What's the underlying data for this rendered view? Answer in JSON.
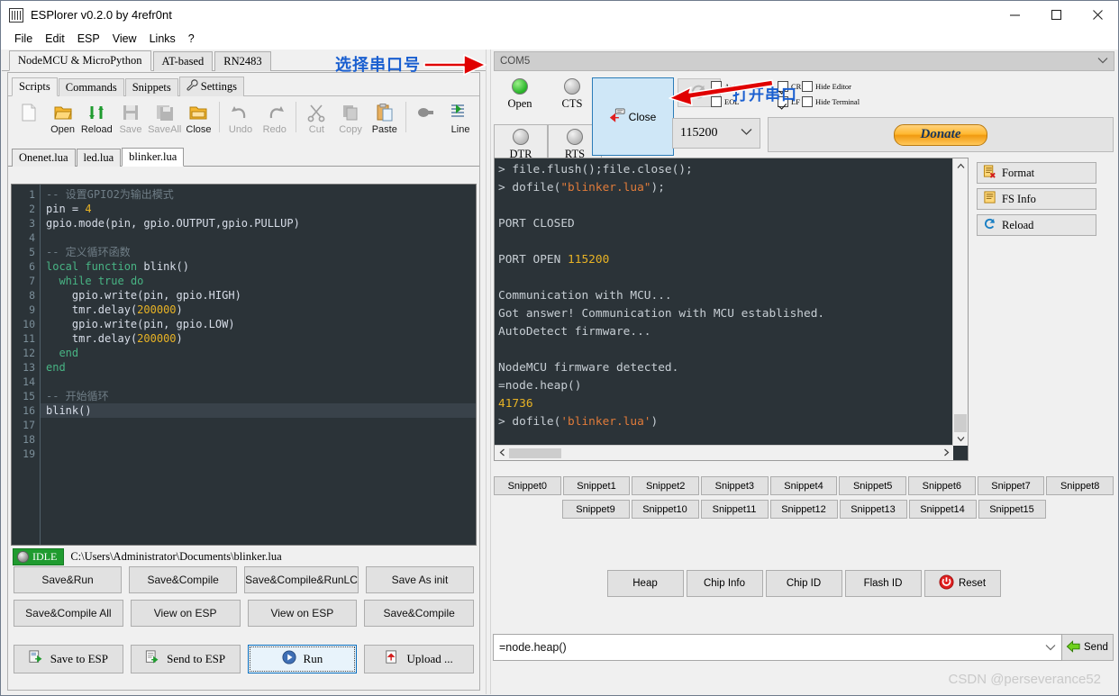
{
  "window": {
    "title": "ESPlorer v0.2.0 by 4refr0nt",
    "minimize": "─",
    "maximize": "☐",
    "close": "✕"
  },
  "menu": [
    "File",
    "Edit",
    "ESP",
    "View",
    "Links",
    "?"
  ],
  "outer_tabs": [
    {
      "label": "NodeMCU & MicroPython",
      "active": true
    },
    {
      "label": "AT-based",
      "active": false
    },
    {
      "label": "RN2483",
      "active": false
    }
  ],
  "inner_tabs": [
    {
      "label": "Scripts",
      "active": true
    },
    {
      "label": "Commands",
      "active": false
    },
    {
      "label": "Snippets",
      "active": false
    },
    {
      "label": "Settings",
      "active": false,
      "icon": "wrench-icon"
    }
  ],
  "editor_toolbar": [
    {
      "label": "",
      "icon": "new-file-icon",
      "disabled": false
    },
    {
      "label": "Open",
      "icon": "open-folder-icon",
      "disabled": false
    },
    {
      "label": "Reload",
      "icon": "reload-icon",
      "disabled": false
    },
    {
      "label": "Save",
      "icon": "save-icon",
      "disabled": true
    },
    {
      "label": "SaveAll",
      "icon": "save-all-icon",
      "disabled": true
    },
    {
      "label": "Close",
      "icon": "close-folder-icon",
      "disabled": false
    },
    {
      "label": "Undo",
      "icon": "undo-icon",
      "disabled": true
    },
    {
      "label": "Redo",
      "icon": "redo-icon",
      "disabled": true
    },
    {
      "label": "Cut",
      "icon": "scissors-icon",
      "disabled": true
    },
    {
      "label": "Copy",
      "icon": "copy-icon",
      "disabled": true
    },
    {
      "label": "Paste",
      "icon": "paste-icon",
      "disabled": false
    },
    {
      "label": "",
      "icon": "block-icon",
      "disabled": true
    },
    {
      "label": "Line",
      "icon": "line-icon",
      "disabled": false
    }
  ],
  "file_tabs": [
    {
      "label": "Onenet.lua",
      "active": false
    },
    {
      "label": "led.lua",
      "active": false
    },
    {
      "label": "blinker.lua",
      "active": true
    }
  ],
  "code": {
    "lines": [
      "1",
      "2",
      "3",
      "4",
      "5",
      "6",
      "7",
      "8",
      "9",
      "10",
      "11",
      "12",
      "13",
      "14",
      "15",
      "16",
      "17",
      "18",
      "19"
    ],
    "text": [
      "-- 设置GPIO2为输出模式",
      "pin = 4",
      "gpio.mode(pin, gpio.OUTPUT,gpio.PULLUP)",
      "",
      "-- 定义循环函数",
      "local function blink()",
      "  while true do",
      "    gpio.write(pin, gpio.HIGH)",
      "    tmr.delay(200000)",
      "    gpio.write(pin, gpio.LOW)",
      "    tmr.delay(200000)",
      "  end",
      "end",
      "",
      "-- 开始循环",
      "blink()",
      "",
      "",
      ""
    ],
    "current_line": 16
  },
  "status": {
    "badge": "IDLE",
    "path": "C:\\Users\\Administrator\\Documents\\blinker.lua"
  },
  "action_buttons_row1": [
    "Save&Run",
    "Save&Compile",
    "Save&Compile&RunLC",
    "Save As init"
  ],
  "action_buttons_row2": [
    "Save&Compile All",
    "View on ESP",
    "View on ESP",
    "Save&Compile"
  ],
  "action_buttons_row3": [
    {
      "label": "Save to ESP",
      "icon": "save-to-esp-icon",
      "focused": false
    },
    {
      "label": "Send to ESP",
      "icon": "send-to-esp-icon",
      "focused": false
    },
    {
      "label": "Run",
      "icon": "run-icon",
      "focused": true
    },
    {
      "label": "Upload ...",
      "icon": "upload-icon",
      "focused": false
    }
  ],
  "serial": {
    "port_value": "COM5",
    "leds": [
      {
        "label": "Open",
        "state": "green"
      },
      {
        "label": "CTS",
        "state": "grey"
      }
    ],
    "buttons": [
      {
        "label": "DTR",
        "state": "grey"
      },
      {
        "label": "RTS",
        "state": "grey"
      }
    ],
    "open_close_label": "Close",
    "open_close_icon": "close-port-icon",
    "refresh_icon": "refresh-icon",
    "baud_value": "115200",
    "donate_label": "Donate",
    "checkboxes": [
      {
        "label": "AutoScroll",
        "checked": true
      },
      {
        "label": "EOL",
        "checked": false
      },
      {
        "label": "CR",
        "checked": true
      },
      {
        "label": "LF",
        "checked": true
      },
      {
        "label": "Hide Editor",
        "checked": false
      },
      {
        "label": "Hide Terminal",
        "checked": false
      }
    ]
  },
  "terminal": {
    "lines": [
      [
        {
          "t": "> file.flush();file.close();",
          "c": "plain"
        }
      ],
      [
        {
          "t": "> dofile(",
          "c": "plain"
        },
        {
          "t": "\"blinker.lua\"",
          "c": "str"
        },
        {
          "t": ");",
          "c": "plain"
        }
      ],
      [
        {
          "t": "",
          "c": "plain"
        }
      ],
      [
        {
          "t": "PORT CLOSED",
          "c": "plain"
        }
      ],
      [
        {
          "t": "",
          "c": "plain"
        }
      ],
      [
        {
          "t": "PORT OPEN ",
          "c": "plain"
        },
        {
          "t": "115200",
          "c": "num"
        }
      ],
      [
        {
          "t": "",
          "c": "plain"
        }
      ],
      [
        {
          "t": "Communication with MCU...",
          "c": "plain"
        }
      ],
      [
        {
          "t": "Got answer! Communication with MCU established.",
          "c": "plain"
        }
      ],
      [
        {
          "t": "AutoDetect firmware...",
          "c": "plain"
        }
      ],
      [
        {
          "t": "",
          "c": "plain"
        }
      ],
      [
        {
          "t": "NodeMCU firmware detected.",
          "c": "plain"
        }
      ],
      [
        {
          "t": "=node.heap()",
          "c": "plain"
        }
      ],
      [
        {
          "t": "41736",
          "c": "num"
        }
      ],
      [
        {
          "t": "> dofile(",
          "c": "plain"
        },
        {
          "t": "'blinker.lua'",
          "c": "str"
        },
        {
          "t": ")",
          "c": "plain"
        }
      ]
    ]
  },
  "right_buttons": [
    {
      "label": "Format",
      "icon": "format-icon"
    },
    {
      "label": "FS Info",
      "icon": "fs-info-icon"
    },
    {
      "label": "Reload",
      "icon": "reload-circle-icon"
    }
  ],
  "snippets_row1": [
    "Snippet0",
    "Snippet1",
    "Snippet2",
    "Snippet3",
    "Snippet4",
    "Snippet5",
    "Snippet6",
    "Snippet7",
    "Snippet8"
  ],
  "snippets_row2": [
    "Snippet9",
    "Snippet10",
    "Snippet11",
    "Snippet12",
    "Snippet13",
    "Snippet14",
    "Snippet15"
  ],
  "info_buttons": [
    {
      "label": "Heap",
      "icon": ""
    },
    {
      "label": "Chip Info",
      "icon": ""
    },
    {
      "label": "Chip ID",
      "icon": ""
    },
    {
      "label": "Flash ID",
      "icon": ""
    },
    {
      "label": "Reset",
      "icon": "power-icon"
    }
  ],
  "command_bar": {
    "value": "=node.heap()",
    "send_label": "Send"
  },
  "watermark": "CSDN @perseverance52",
  "annotations": [
    {
      "text": "选择串口号",
      "name": "annotation-select-com-port"
    },
    {
      "text": "打开串口",
      "name": "annotation-open-com-port"
    }
  ],
  "colors": {
    "accent": "#1a5fd0",
    "arrow": "#e00000",
    "terminal_bg": "#2b3338",
    "editor_bg": "#2b3338",
    "status_green": "#1f9b2f"
  }
}
